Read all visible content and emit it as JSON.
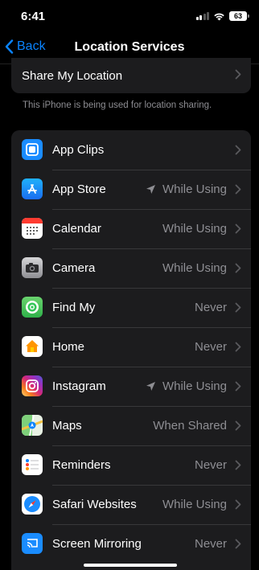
{
  "status_bar": {
    "time": "6:41",
    "battery": "63"
  },
  "nav": {
    "back_label": "Back",
    "title": "Location Services"
  },
  "share": {
    "label": "Share My Location",
    "footer": "This iPhone is being used for location sharing."
  },
  "apps": [
    {
      "name": "App Clips",
      "status": "",
      "icon": "app-clips-icon",
      "arrow": false
    },
    {
      "name": "App Store",
      "status": "While Using",
      "icon": "app-store-icon",
      "arrow": true
    },
    {
      "name": "Calendar",
      "status": "While Using",
      "icon": "calendar-icon",
      "arrow": false
    },
    {
      "name": "Camera",
      "status": "While Using",
      "icon": "camera-icon",
      "arrow": false
    },
    {
      "name": "Find My",
      "status": "Never",
      "icon": "find-my-icon",
      "arrow": false
    },
    {
      "name": "Home",
      "status": "Never",
      "icon": "home-icon",
      "arrow": false
    },
    {
      "name": "Instagram",
      "status": "While Using",
      "icon": "instagram-icon",
      "arrow": true
    },
    {
      "name": "Maps",
      "status": "When Shared",
      "icon": "maps-icon",
      "arrow": false
    },
    {
      "name": "Reminders",
      "status": "Never",
      "icon": "reminders-icon",
      "arrow": false
    },
    {
      "name": "Safari Websites",
      "status": "While Using",
      "icon": "safari-icon",
      "arrow": false
    },
    {
      "name": "Screen Mirroring",
      "status": "Never",
      "icon": "screen-mirroring-icon",
      "arrow": false
    }
  ],
  "colors": {
    "accent": "#0a84ff",
    "background": "#000000",
    "card": "#1c1c1e",
    "secondary_text": "#8e8e93"
  }
}
